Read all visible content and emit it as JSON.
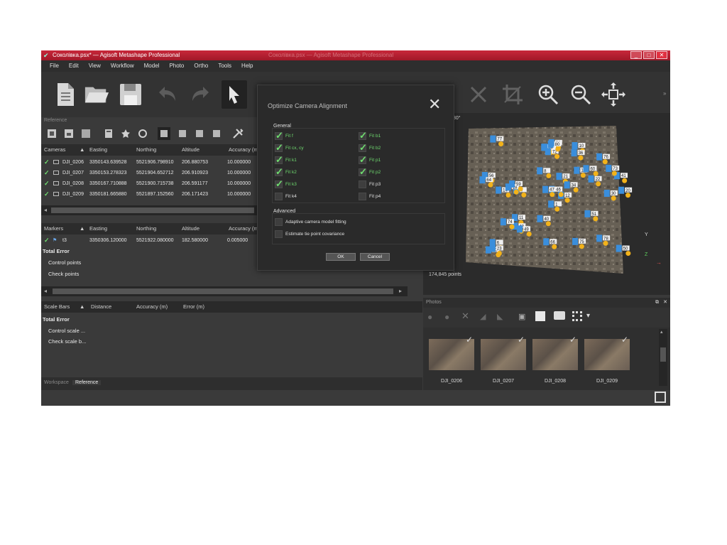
{
  "window": {
    "title": "Соколівка.psx* — Agisoft Metashape Professional",
    "ghost_title": "Соколівка.psx — Agisoft Metashape Professional",
    "controls": [
      "_",
      "□",
      "✕"
    ]
  },
  "menu": [
    "File",
    "Edit",
    "View",
    "Workflow",
    "Model",
    "Photo",
    "Ortho",
    "Tools",
    "Help"
  ],
  "toolbar": {
    "icons": [
      "new-document-icon",
      "open-folder-icon",
      "save-icon",
      "undo-icon",
      "redo-icon",
      "pointer-icon",
      "delete-icon",
      "crop-icon",
      "zoom-in-icon",
      "zoom-out-icon",
      "reset-view-icon"
    ]
  },
  "reference": {
    "panel_label": "Reference",
    "cameras_header": {
      "cols": [
        "Cameras",
        "Easting",
        "Northing",
        "Altitude",
        "Accuracy (m"
      ]
    },
    "cameras": [
      {
        "name": "DJI_0206",
        "easting": "3350143.639528",
        "northing": "5521906.798910",
        "altitude": "206.880753",
        "accuracy": "10.000000"
      },
      {
        "name": "DJI_0207",
        "easting": "3350153.278323",
        "northing": "5521904.652712",
        "altitude": "206.910923",
        "accuracy": "10.000000"
      },
      {
        "name": "DJI_0208",
        "easting": "3350167.710888",
        "northing": "5521900.715738",
        "altitude": "206.591177",
        "accuracy": "10.000000"
      },
      {
        "name": "DJI_0209",
        "easting": "3350181.665880",
        "northing": "5521897.152560",
        "altitude": "206.171423",
        "accuracy": "10.000000"
      }
    ],
    "markers_header": {
      "cols": [
        "Markers",
        "Easting",
        "Northing",
        "Altitude",
        "Accuracy (m"
      ]
    },
    "markers": [
      {
        "name": "t3",
        "easting": "3350306.120000",
        "northing": "5521922.080000",
        "altitude": "182.580000",
        "accuracy": "0.005000"
      }
    ],
    "total_error": "Total Error",
    "control_points": "Control points",
    "check_points": "Check points",
    "scalebars_header": {
      "cols": [
        "Scale Bars",
        "Distance",
        "Accuracy (m)",
        "Error (m)"
      ]
    },
    "scale_total_error": "Total Error",
    "control_scale": "Control scale ...",
    "check_scale": "Check scale b..."
  },
  "bottom_tabs": [
    "Workspace",
    "Reference"
  ],
  "model_view": {
    "points_label": "174,845 points",
    "angle_label": "30°",
    "axis_y": "Y",
    "axis_z": "Z"
  },
  "photos": {
    "header": "Photos",
    "items": [
      {
        "label": "DJI_0206"
      },
      {
        "label": "DJI_0207"
      },
      {
        "label": "DJI_0208"
      },
      {
        "label": "DJI_0209"
      }
    ]
  },
  "dialog": {
    "title": "Optimize Camera Alignment",
    "general_label": "General",
    "options_left": [
      {
        "label": "Fit f",
        "checked": true
      },
      {
        "label": "Fit cx, cy",
        "checked": true
      },
      {
        "label": "Fit k1",
        "checked": true
      },
      {
        "label": "Fit k2",
        "checked": true
      },
      {
        "label": "Fit k3",
        "checked": true
      },
      {
        "label": "Fit k4",
        "checked": false
      }
    ],
    "options_right": [
      {
        "label": "Fit b1",
        "checked": true
      },
      {
        "label": "Fit b2",
        "checked": true
      },
      {
        "label": "Fit p1",
        "checked": true
      },
      {
        "label": "Fit p2",
        "checked": true
      },
      {
        "label": "Fit p3",
        "checked": false
      },
      {
        "label": "Fit p4",
        "checked": false
      }
    ],
    "advanced_label": "Advanced",
    "adaptive": "Adaptive camera model fitting",
    "covariance": "Estimate tie point covariance",
    "ok": "OK",
    "cancel": "Cancel"
  },
  "camera_markers": [
    "1",
    "4",
    "6",
    "8",
    "10",
    "11",
    "12",
    "13",
    "14",
    "18",
    "19",
    "20",
    "21",
    "22",
    "23",
    "30",
    "34",
    "36",
    "39",
    "40",
    "41",
    "46",
    "47",
    "48",
    "49",
    "50",
    "51",
    "56",
    "59",
    "60",
    "64",
    "65",
    "66",
    "72",
    "73",
    "74",
    "75",
    "76",
    "77",
    "78",
    "79",
    "80"
  ],
  "colors": {
    "title_red": "#b0202e",
    "check_green": "#6fdc6f",
    "camera_blue": "#3a8edc",
    "marker_yellow": "#f2b21a"
  }
}
